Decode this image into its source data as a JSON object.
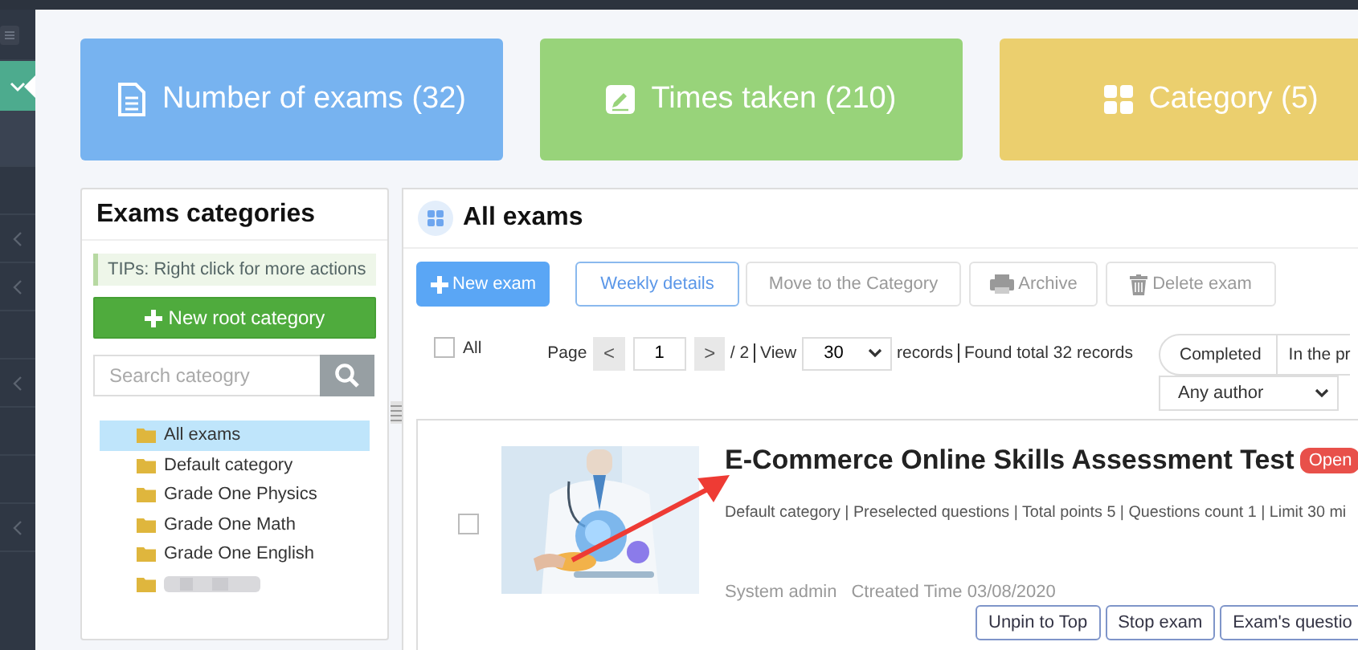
{
  "sidebar": {
    "items": [
      {
        "kind": "menu",
        "selected": false
      },
      {
        "kind": "expand",
        "selected": true
      },
      {
        "kind": "plain",
        "selected": false
      },
      {
        "kind": "plain",
        "selected": false
      },
      {
        "kind": "collapse",
        "selected": false
      },
      {
        "kind": "collapse",
        "selected": false
      },
      {
        "kind": "plain",
        "selected": false
      },
      {
        "kind": "collapse",
        "selected": false
      },
      {
        "kind": "plain",
        "selected": false
      },
      {
        "kind": "plain",
        "selected": false
      },
      {
        "kind": "collapse",
        "selected": false
      }
    ]
  },
  "stats": [
    {
      "kind": "document",
      "label": "Number of exams (32)",
      "color": "#77b3f0"
    },
    {
      "kind": "pencil",
      "label": "Times taken (210)",
      "color": "#98d37a"
    },
    {
      "kind": "grid",
      "label": "Category (5)",
      "color": "#ebcf6e"
    }
  ],
  "categories": {
    "title": "Exams categories",
    "tip": "TIPs:  Right click for more actions",
    "new_button": "New root category",
    "search": {
      "placeholder": "Search cateogry"
    },
    "items": [
      {
        "label": "All exams",
        "selected": true,
        "blurred": false
      },
      {
        "label": "Default category",
        "selected": false,
        "blurred": false
      },
      {
        "label": "Grade One Physics",
        "selected": false,
        "blurred": false
      },
      {
        "label": "Grade One Math",
        "selected": false,
        "blurred": false
      },
      {
        "label": "Grade One English",
        "selected": false,
        "blurred": false
      },
      {
        "selected": false,
        "blurred": true
      }
    ]
  },
  "exams": {
    "title": "All exams",
    "toolbar": [
      {
        "kind": "create",
        "label": "New exam"
      },
      {
        "kind": "weekly",
        "label": "Weekly details"
      },
      {
        "kind": "move",
        "label": "Move to the Category"
      },
      {
        "kind": "archive",
        "label": "Archive"
      },
      {
        "kind": "delete",
        "label": "Delete exam"
      }
    ],
    "select_all": {
      "label": "All",
      "checked": false
    },
    "pager": {
      "page_label": "Page",
      "prev": "<",
      "page": "1",
      "next": ">",
      "total": "/ 2",
      "view_label": "View",
      "per_page": "30",
      "records_label": "records",
      "found": "Found total 32 records"
    },
    "status_tabs": [
      {
        "label": "Completed",
        "selected": false
      },
      {
        "label": "In the pr",
        "selected": false
      }
    ],
    "author_filter": "Any author",
    "list": [
      {
        "checked": false,
        "title": "E-Commerce Online Skills Assessment Test",
        "badge": "Open",
        "meta": "Default category | Preselected questions | Total points 5 | Questions count 1 | Limit 30 mi",
        "author": "System admin",
        "created": "Ctreated Time 03/08/2020",
        "actions": [
          "Unpin to Top",
          "Stop exam",
          "Exam's questio"
        ]
      }
    ]
  }
}
